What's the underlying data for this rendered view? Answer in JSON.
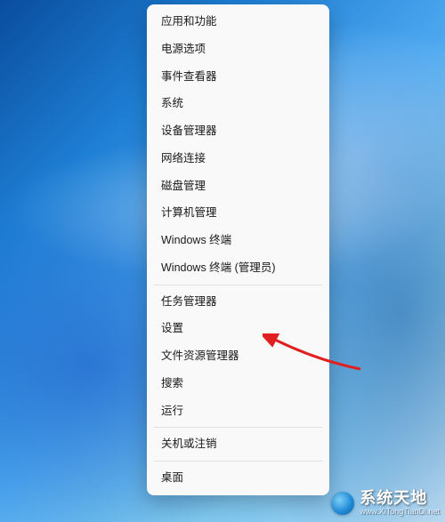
{
  "menu": {
    "groups": [
      [
        {
          "id": "apps-features",
          "label": "应用和功能"
        },
        {
          "id": "power-options",
          "label": "电源选项"
        },
        {
          "id": "event-viewer",
          "label": "事件查看器"
        },
        {
          "id": "system",
          "label": "系统"
        },
        {
          "id": "device-manager",
          "label": "设备管理器"
        },
        {
          "id": "network-connections",
          "label": "网络连接"
        },
        {
          "id": "disk-management",
          "label": "磁盘管理"
        },
        {
          "id": "computer-management",
          "label": "计算机管理"
        },
        {
          "id": "windows-terminal",
          "label": "Windows 终端"
        },
        {
          "id": "windows-terminal-admin",
          "label": "Windows 终端 (管理员)"
        }
      ],
      [
        {
          "id": "task-manager",
          "label": "任务管理器"
        },
        {
          "id": "settings",
          "label": "设置"
        },
        {
          "id": "file-explorer",
          "label": "文件资源管理器"
        },
        {
          "id": "search",
          "label": "搜索"
        },
        {
          "id": "run",
          "label": "运行"
        }
      ],
      [
        {
          "id": "shutdown-signout",
          "label": "关机或注销"
        }
      ],
      [
        {
          "id": "desktop",
          "label": "桌面"
        }
      ]
    ]
  },
  "watermark": {
    "brand": "系统天地",
    "url": "www.XiTongTianDi.net"
  },
  "annotation": {
    "arrow_target": "task-manager",
    "arrow_color": "#e02020"
  }
}
